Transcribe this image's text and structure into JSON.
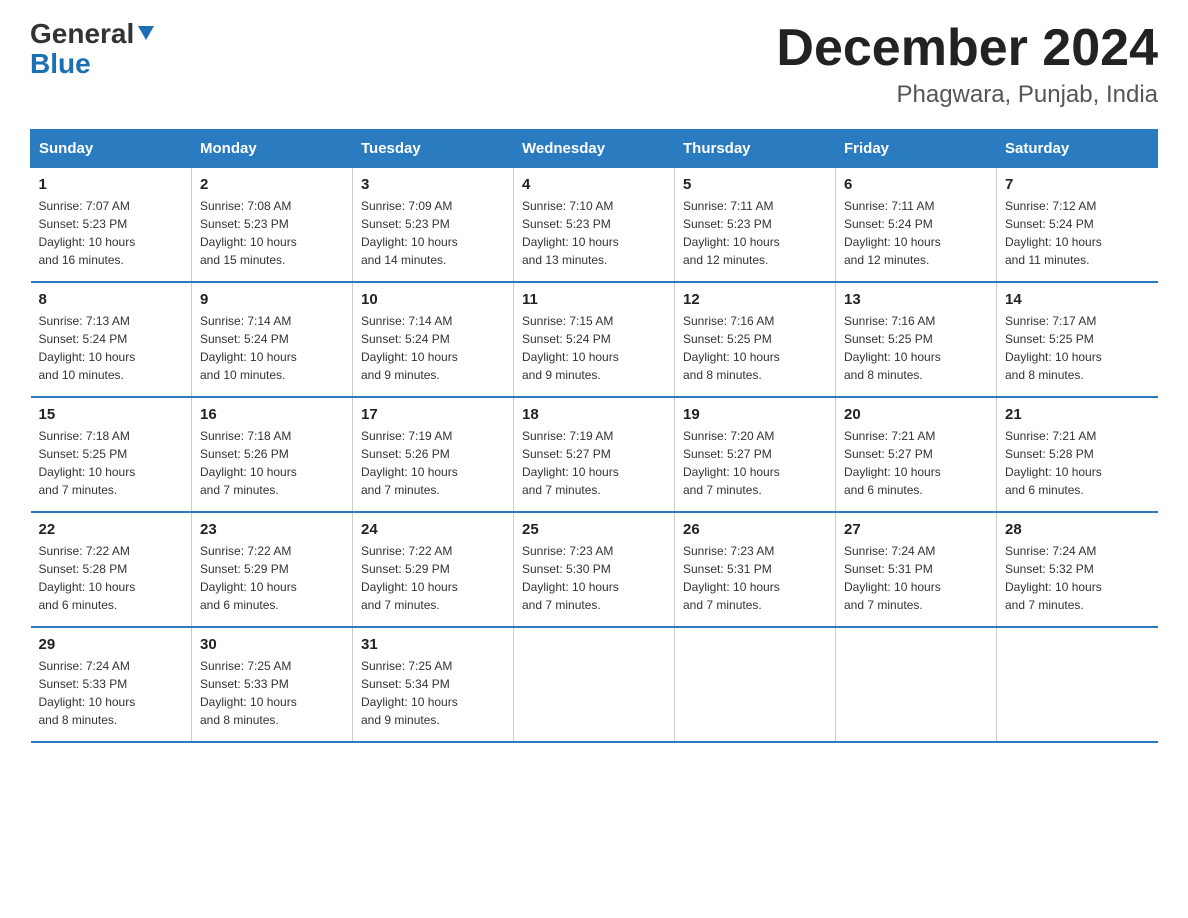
{
  "header": {
    "logo_general": "General",
    "logo_blue": "Blue",
    "month": "December 2024",
    "location": "Phagwara, Punjab, India"
  },
  "days_of_week": [
    "Sunday",
    "Monday",
    "Tuesday",
    "Wednesday",
    "Thursday",
    "Friday",
    "Saturday"
  ],
  "weeks": [
    [
      {
        "day": "1",
        "sunrise": "7:07 AM",
        "sunset": "5:23 PM",
        "daylight": "10 hours and 16 minutes."
      },
      {
        "day": "2",
        "sunrise": "7:08 AM",
        "sunset": "5:23 PM",
        "daylight": "10 hours and 15 minutes."
      },
      {
        "day": "3",
        "sunrise": "7:09 AM",
        "sunset": "5:23 PM",
        "daylight": "10 hours and 14 minutes."
      },
      {
        "day": "4",
        "sunrise": "7:10 AM",
        "sunset": "5:23 PM",
        "daylight": "10 hours and 13 minutes."
      },
      {
        "day": "5",
        "sunrise": "7:11 AM",
        "sunset": "5:23 PM",
        "daylight": "10 hours and 12 minutes."
      },
      {
        "day": "6",
        "sunrise": "7:11 AM",
        "sunset": "5:24 PM",
        "daylight": "10 hours and 12 minutes."
      },
      {
        "day": "7",
        "sunrise": "7:12 AM",
        "sunset": "5:24 PM",
        "daylight": "10 hours and 11 minutes."
      }
    ],
    [
      {
        "day": "8",
        "sunrise": "7:13 AM",
        "sunset": "5:24 PM",
        "daylight": "10 hours and 10 minutes."
      },
      {
        "day": "9",
        "sunrise": "7:14 AM",
        "sunset": "5:24 PM",
        "daylight": "10 hours and 10 minutes."
      },
      {
        "day": "10",
        "sunrise": "7:14 AM",
        "sunset": "5:24 PM",
        "daylight": "10 hours and 9 minutes."
      },
      {
        "day": "11",
        "sunrise": "7:15 AM",
        "sunset": "5:24 PM",
        "daylight": "10 hours and 9 minutes."
      },
      {
        "day": "12",
        "sunrise": "7:16 AM",
        "sunset": "5:25 PM",
        "daylight": "10 hours and 8 minutes."
      },
      {
        "day": "13",
        "sunrise": "7:16 AM",
        "sunset": "5:25 PM",
        "daylight": "10 hours and 8 minutes."
      },
      {
        "day": "14",
        "sunrise": "7:17 AM",
        "sunset": "5:25 PM",
        "daylight": "10 hours and 8 minutes."
      }
    ],
    [
      {
        "day": "15",
        "sunrise": "7:18 AM",
        "sunset": "5:25 PM",
        "daylight": "10 hours and 7 minutes."
      },
      {
        "day": "16",
        "sunrise": "7:18 AM",
        "sunset": "5:26 PM",
        "daylight": "10 hours and 7 minutes."
      },
      {
        "day": "17",
        "sunrise": "7:19 AM",
        "sunset": "5:26 PM",
        "daylight": "10 hours and 7 minutes."
      },
      {
        "day": "18",
        "sunrise": "7:19 AM",
        "sunset": "5:27 PM",
        "daylight": "10 hours and 7 minutes."
      },
      {
        "day": "19",
        "sunrise": "7:20 AM",
        "sunset": "5:27 PM",
        "daylight": "10 hours and 7 minutes."
      },
      {
        "day": "20",
        "sunrise": "7:21 AM",
        "sunset": "5:27 PM",
        "daylight": "10 hours and 6 minutes."
      },
      {
        "day": "21",
        "sunrise": "7:21 AM",
        "sunset": "5:28 PM",
        "daylight": "10 hours and 6 minutes."
      }
    ],
    [
      {
        "day": "22",
        "sunrise": "7:22 AM",
        "sunset": "5:28 PM",
        "daylight": "10 hours and 6 minutes."
      },
      {
        "day": "23",
        "sunrise": "7:22 AM",
        "sunset": "5:29 PM",
        "daylight": "10 hours and 6 minutes."
      },
      {
        "day": "24",
        "sunrise": "7:22 AM",
        "sunset": "5:29 PM",
        "daylight": "10 hours and 7 minutes."
      },
      {
        "day": "25",
        "sunrise": "7:23 AM",
        "sunset": "5:30 PM",
        "daylight": "10 hours and 7 minutes."
      },
      {
        "day": "26",
        "sunrise": "7:23 AM",
        "sunset": "5:31 PM",
        "daylight": "10 hours and 7 minutes."
      },
      {
        "day": "27",
        "sunrise": "7:24 AM",
        "sunset": "5:31 PM",
        "daylight": "10 hours and 7 minutes."
      },
      {
        "day": "28",
        "sunrise": "7:24 AM",
        "sunset": "5:32 PM",
        "daylight": "10 hours and 7 minutes."
      }
    ],
    [
      {
        "day": "29",
        "sunrise": "7:24 AM",
        "sunset": "5:33 PM",
        "daylight": "10 hours and 8 minutes."
      },
      {
        "day": "30",
        "sunrise": "7:25 AM",
        "sunset": "5:33 PM",
        "daylight": "10 hours and 8 minutes."
      },
      {
        "day": "31",
        "sunrise": "7:25 AM",
        "sunset": "5:34 PM",
        "daylight": "10 hours and 9 minutes."
      },
      null,
      null,
      null,
      null
    ]
  ],
  "labels": {
    "sunrise": "Sunrise:",
    "sunset": "Sunset:",
    "daylight": "Daylight:"
  }
}
